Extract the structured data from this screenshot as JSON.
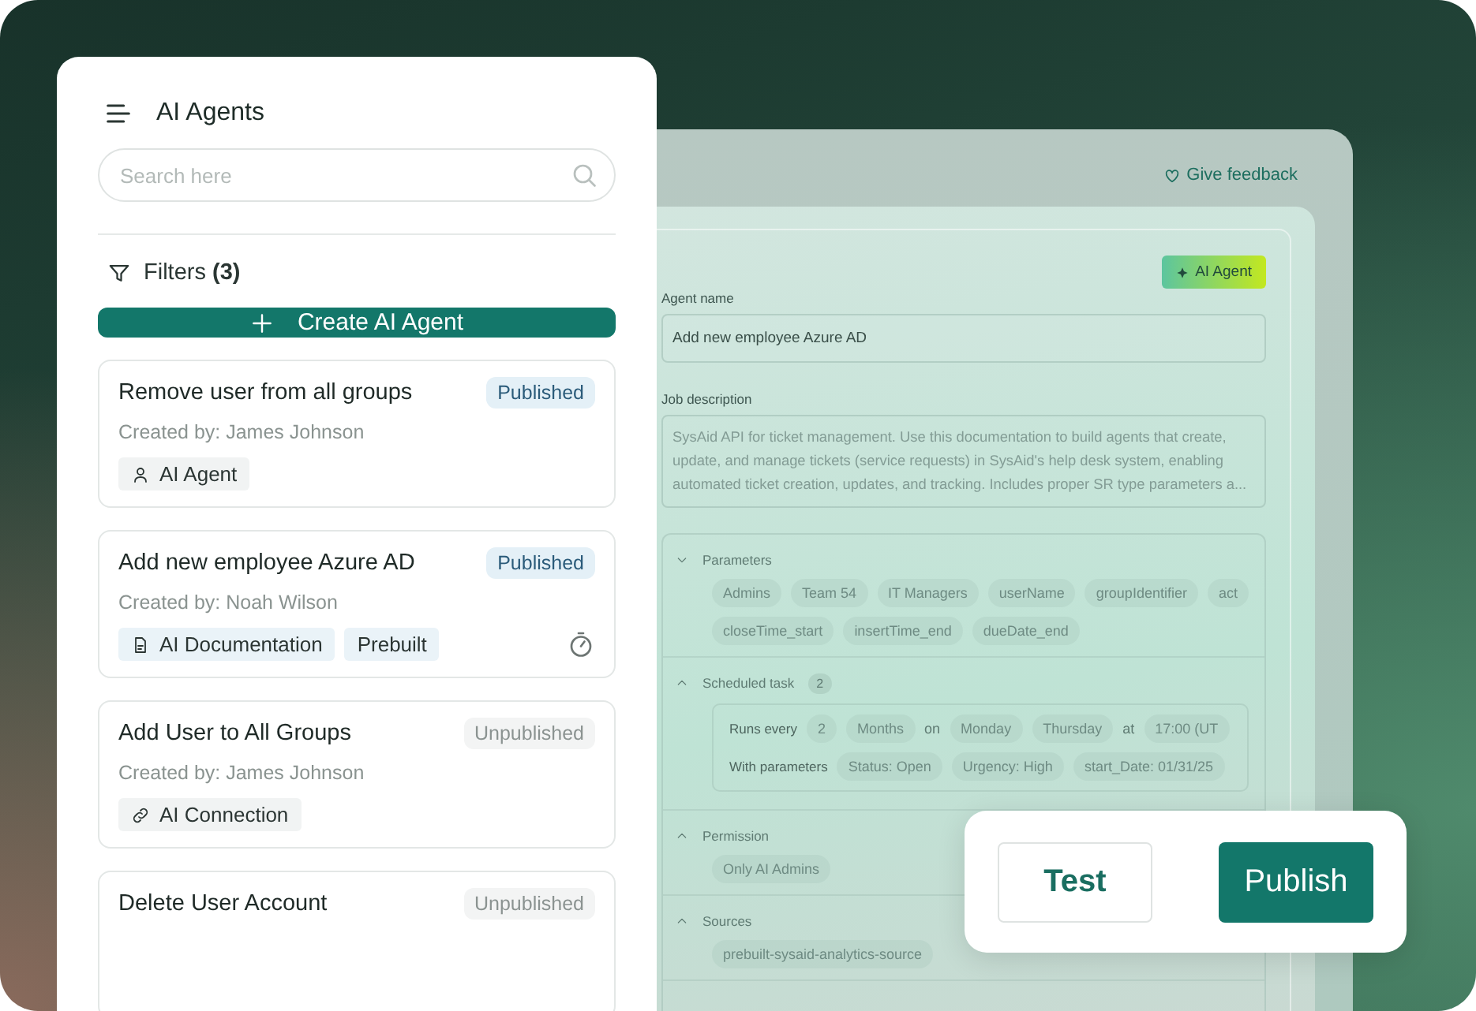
{
  "sidebar": {
    "title": "AI Agents",
    "search": {
      "placeholder": "Search here"
    },
    "filters": {
      "label": "Filters",
      "count": "(3)"
    },
    "create_button": "Create AI Agent",
    "agents": [
      {
        "title": "Remove user from all groups",
        "status": "Published",
        "published": true,
        "creator": "Created by: James Johnson",
        "scheduled": false,
        "tags": [
          {
            "kind": "agent",
            "label": "AI Agent",
            "color": "#f1f3f3"
          }
        ]
      },
      {
        "title": "Add new employee Azure AD",
        "status": "Published",
        "published": true,
        "creator": "Created by: Noah Wilson",
        "scheduled": true,
        "tags": [
          {
            "kind": "doc",
            "label": "AI Documentation",
            "color": "#eaf3f8"
          },
          {
            "kind": "plain",
            "label": "Prebuilt",
            "color": "#eaf3f8"
          }
        ]
      },
      {
        "title": "Add User to All Groups",
        "status": "Unpublished",
        "published": false,
        "creator": "Created by: James Johnson",
        "scheduled": false,
        "tags": [
          {
            "kind": "link",
            "label": "AI Connection",
            "color": "#f1f3f3"
          }
        ]
      },
      {
        "title": "Delete User Account",
        "status": "Unpublished",
        "published": false,
        "scheduled": false
      }
    ]
  },
  "editor": {
    "feedback": "Give feedback",
    "badge": "AI Agent",
    "fields": [
      {
        "kind": "input",
        "label": "Agent name",
        "value": "Add new employee Azure AD"
      },
      {
        "kind": "textarea",
        "label": "Job description",
        "value": "SysAid API for ticket management. Use this documentation to build agents that create, update, and manage tickets (service requests) in SysAid's help desk system, enabling automated ticket creation, updates, and tracking. Includes proper SR type parameters a..."
      }
    ],
    "sections": [
      {
        "kind": "chips",
        "title": "Parameters",
        "expanded": true,
        "chip_rows": [
          [
            "Admins",
            "Team 54",
            "IT Managers",
            "userName",
            "groupIdentifier",
            "act"
          ],
          [
            "closeTime_start",
            "insertTime_end",
            "dueDate_end"
          ]
        ]
      },
      {
        "kind": "schedule",
        "title": "Scheduled task",
        "count": "2",
        "expanded": false,
        "rows": [
          {
            "label": "Runs every",
            "items": [
              {
                "kind": "chip",
                "text": "2"
              },
              {
                "kind": "chip",
                "text": "Months"
              },
              {
                "kind": "word",
                "text": "on"
              },
              {
                "kind": "chip",
                "text": "Monday"
              },
              {
                "kind": "chip",
                "text": "Thursday"
              },
              {
                "kind": "word",
                "text": "at"
              },
              {
                "kind": "chip",
                "text": "17:00 (UT"
              }
            ]
          },
          {
            "label": "With parameters",
            "items": [
              {
                "kind": "chip",
                "text": "Status: Open"
              },
              {
                "kind": "chip",
                "text": "Urgency: High"
              },
              {
                "kind": "chip",
                "text": "start_Date: 01/31/25"
              }
            ]
          }
        ]
      },
      {
        "kind": "chips",
        "title": "Permission",
        "expanded": false,
        "chip_rows": [
          [
            "Only AI Admins"
          ]
        ]
      },
      {
        "kind": "chips",
        "title": "Sources",
        "expanded": false,
        "chip_rows": [
          [
            "prebuilt-sysaid-analytics-source"
          ]
        ]
      }
    ]
  },
  "actions": [
    {
      "kind": "secondary",
      "label": "Test"
    },
    {
      "kind": "primary",
      "label": "Publish"
    }
  ]
}
